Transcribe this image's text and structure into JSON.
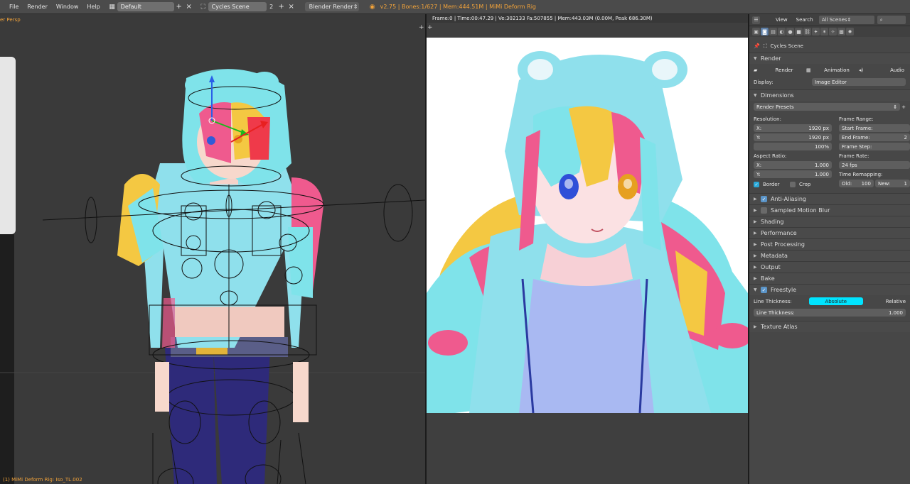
{
  "topbar": {
    "menus": [
      "File",
      "Render",
      "Window",
      "Help"
    ],
    "layout_value": "Default",
    "scene_value": "Cycles Scene",
    "scene_users": "2",
    "engine_value": "Blender Render",
    "status": "v2.75 | Bones:1/627 | Mem:444.51M | MiMi Deform Rig"
  },
  "viewport": {
    "view_label": "er Persp",
    "bottom_label": "(1) MiMi Deform Rig: Iso_TL.002"
  },
  "image_editor": {
    "render_info": "Frame:0 | Time:00:47.29 | Ve:302133 Fa:507855 | Mem:443.03M (0.00M, Peak 686.30M)"
  },
  "properties": {
    "header": {
      "view": "View",
      "search": "Search",
      "filter": "All Scenes"
    },
    "scene_name": "Cycles Scene",
    "render_panel": {
      "title": "Render",
      "render_btn": "Render",
      "animation_btn": "Animation",
      "audio_btn": "Audio",
      "display_label": "Display:",
      "display_value": "Image Editor"
    },
    "dimensions": {
      "title": "Dimensions",
      "presets": "Render Presets",
      "resolution_label": "Resolution:",
      "res_x_label": "X:",
      "res_x": "1920 px",
      "res_y_label": "Y:",
      "res_y": "1920 px",
      "res_pct": "100%",
      "aspect_label": "Aspect Ratio:",
      "asp_x_label": "X:",
      "asp_x": "1.000",
      "asp_y_label": "Y:",
      "asp_y": "1.000",
      "border_label": "Border",
      "crop_label": "Crop",
      "frame_range_label": "Frame Range:",
      "start_frame_label": "Start Frame:",
      "end_frame_label": "End Frame:",
      "end_frame": "2",
      "frame_step_label": "Frame Step:",
      "frame_rate_label": "Frame Rate:",
      "fps": "24 fps",
      "time_remap_label": "Time Remapping:",
      "old_label": "Old:",
      "old_value": "100",
      "new_label": "New:",
      "new_value": "1"
    },
    "collapsed_panels": [
      {
        "label": "Anti-Aliasing",
        "checkbox": true,
        "checked": true
      },
      {
        "label": "Sampled Motion Blur",
        "checkbox": true,
        "checked": false
      },
      {
        "label": "Shading",
        "checkbox": false
      },
      {
        "label": "Performance",
        "checkbox": false
      },
      {
        "label": "Post Processing",
        "checkbox": false
      },
      {
        "label": "Metadata",
        "checkbox": false
      },
      {
        "label": "Output",
        "checkbox": false
      },
      {
        "label": "Bake",
        "checkbox": false
      }
    ],
    "freestyle": {
      "title": "Freestyle",
      "thickness_label": "Line Thickness:",
      "absolute": "Absolute",
      "relative": "Relative",
      "thickness_field_label": "Line Thickness:",
      "thickness_value": "1.000"
    },
    "texture_atlas": "Texture Atlas"
  },
  "colors": {
    "accent_status": "#f2a33a",
    "active_toggle": "#00e4ff",
    "hair_cyan": "#7fe3ea",
    "hair_pink": "#ef5a8e",
    "hair_yellow": "#f4c842",
    "hoodie": "#8fe0ec",
    "pants": "#2e2a7a"
  }
}
